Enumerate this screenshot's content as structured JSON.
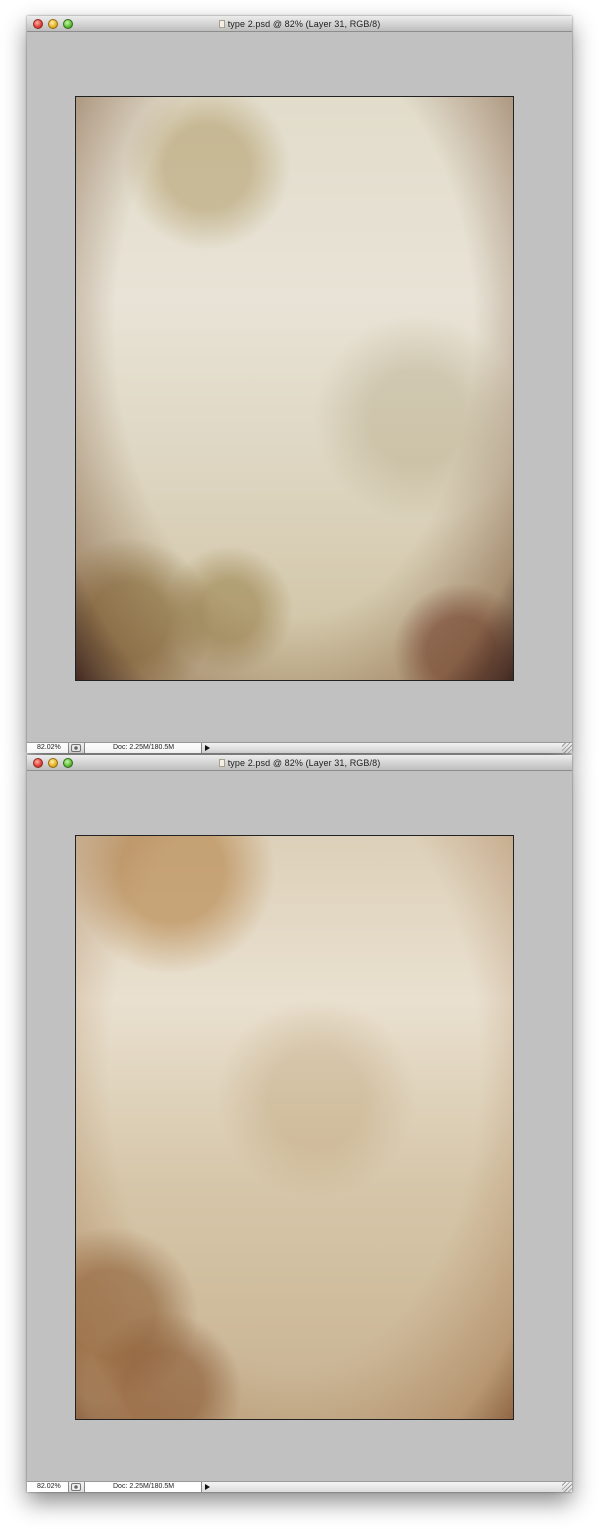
{
  "windows": [
    {
      "title": "type 2.psd @ 82% (Layer 31, RGB/8)",
      "zoom": "82.02%",
      "doc_info": "Doc: 2.25M/180.5M"
    },
    {
      "title": "type 2.psd @ 82% (Layer 31, RGB/8)",
      "zoom": "82.02%",
      "doc_info": "Doc: 2.25M/180.5M"
    }
  ]
}
